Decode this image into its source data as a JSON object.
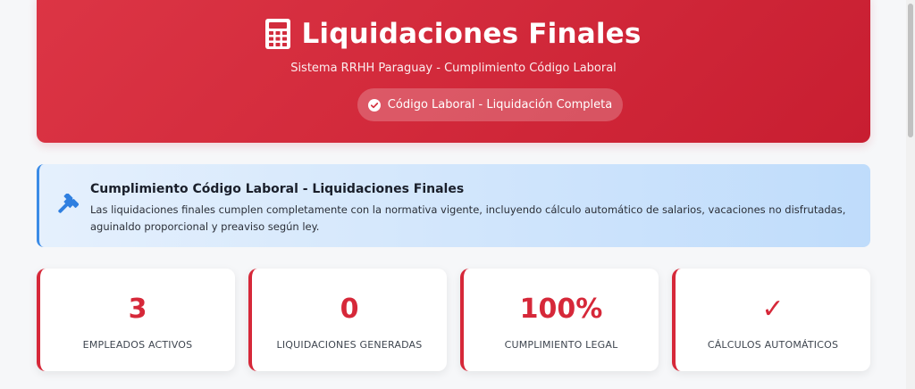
{
  "header": {
    "title": "Liquidaciones Finales",
    "subtitle": "Sistema RRHH Paraguay - Cumplimiento Código Laboral",
    "badge": "Código Laboral - Liquidación Completa",
    "icon": "calculator-icon",
    "badge_icon": "check-circle-icon",
    "background_color": "#dc3545"
  },
  "alert": {
    "icon": "gavel-icon",
    "title": "Cumplimiento Código Laboral - Liquidaciones Finales",
    "text": "Las liquidaciones finales cumplen completamente con la normativa vigente, incluyendo cálculo automático de salarios, vacaciones no disfrutadas, aguinaldo proporcional y preaviso según ley."
  },
  "stats": [
    {
      "value": "3",
      "label": "EMPLEADOS ACTIVOS"
    },
    {
      "value": "0",
      "label": "LIQUIDACIONES GENERADAS"
    },
    {
      "value": "100%",
      "label": "CUMPLIMIENTO LEGAL"
    },
    {
      "value": "✓",
      "label": "CÁLCULOS AUTOMÁTICOS"
    }
  ],
  "colors": {
    "accent": "#d62839",
    "info": "#3b8be6"
  }
}
